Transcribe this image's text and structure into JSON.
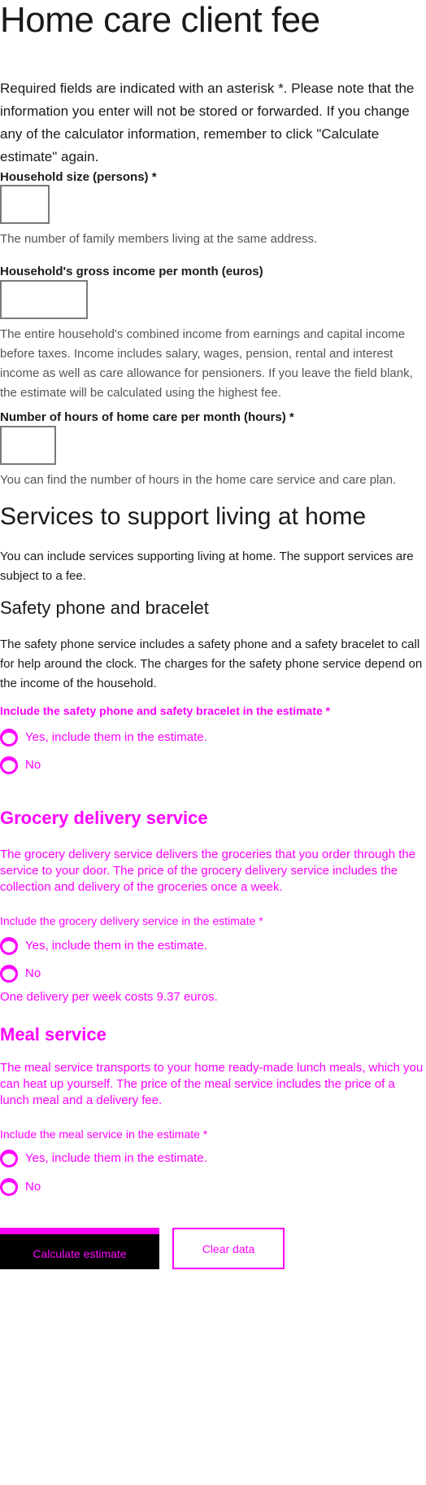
{
  "page": {
    "title": "Home care client fee",
    "intro": "Required fields are indicated with an asterisk *. Please note that the information you enter will not be stored or forwarded. If you change any of the calculator information, remember to click \"Calculate estimate\" again."
  },
  "fields": {
    "household_size": {
      "label": "Household size (persons) *",
      "value": "",
      "help": "The number of family members living at the same address."
    },
    "gross_income": {
      "label": "Household's gross income per month (euros)",
      "value": "",
      "help": "The entire household's combined income from earnings and capital income before taxes. Income includes salary, wages, pension, rental and interest income as well as care allowance for pensioners. If you leave the field blank, the estimate will be calculated using the highest fee."
    },
    "care_hours": {
      "label": "Number of hours of home care per month (hours) *",
      "value": "",
      "help": "You can find the number of hours in the home care service and care plan."
    }
  },
  "services": {
    "title": "Services to support living at home",
    "intro": "You can include services supporting living at home. The support services are subject to a fee."
  },
  "safety_phone": {
    "title": "Safety phone and bracelet",
    "description": "The safety phone service includes a safety phone and a safety bracelet to call for help around the clock. The charges for the safety phone service depend on the income of the household.",
    "question": "Include the safety phone and safety bracelet in the estimate *",
    "option_yes": "Yes, include them in the estimate.",
    "option_no": "No"
  },
  "grocery": {
    "title": "Grocery delivery service",
    "description": "The grocery delivery service delivers the groceries that you order through the service to your door. The price of the grocery delivery service includes the collection and delivery of the groceries once a week.",
    "question": "Include the grocery delivery service in the estimate *",
    "option_yes": "Yes, include them in the estimate.",
    "option_no": "No",
    "note": "One delivery per week costs 9.37 euros."
  },
  "meal": {
    "title": "Meal service",
    "description": "The meal service transports to your home ready-made lunch meals, which you can heat up yourself. The price of the meal service includes the price of a lunch meal and a delivery fee.",
    "question": "Include the meal service in the estimate *",
    "option_yes": "Yes, include them in the estimate.",
    "option_no": "No"
  },
  "actions": {
    "calculate": "Calculate estimate",
    "clear": "Clear data"
  },
  "colors": {
    "text": "#1a1a1a",
    "help_text": "#555555",
    "input_border": "#7a7a7a",
    "overlay_magenta": "#ff00ff",
    "primary_button_bg": "#000000"
  }
}
